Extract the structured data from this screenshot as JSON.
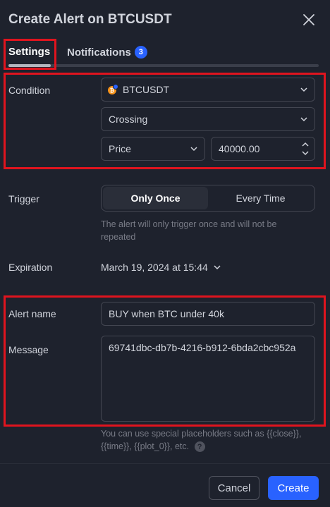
{
  "dialog": {
    "title": "Create Alert on BTCUSDT"
  },
  "tabs": {
    "settings": "Settings",
    "notifications": "Notifications",
    "notifications_count": "3"
  },
  "condition": {
    "label": "Condition",
    "symbol": "BTCUSDT",
    "operator": "Crossing",
    "value_type": "Price",
    "value": "40000.00"
  },
  "trigger": {
    "label": "Trigger",
    "options": [
      "Only Once",
      "Every Time"
    ],
    "selected": "Only Once",
    "hint_line1": "The alert will only trigger once and will not be",
    "hint_line2": "repeated"
  },
  "expiration": {
    "label": "Expiration",
    "value": "March 19, 2024 at 15:44"
  },
  "alert_name": {
    "label": "Alert name",
    "value": "BUY when BTC under 40k"
  },
  "message": {
    "label": "Message",
    "value": "69741dbc-db7b-4216-b912-6bda2cbc952a",
    "hint_line1": "You can use special placeholders such as {{close}},",
    "hint_line2": "{{time}}, {{plot_0}}, etc."
  },
  "footer": {
    "cancel": "Cancel",
    "create": "Create"
  },
  "colors": {
    "background": "#1e222d",
    "accent": "#2962ff",
    "highlight": "#e0141e",
    "coin": "#f7931a"
  }
}
